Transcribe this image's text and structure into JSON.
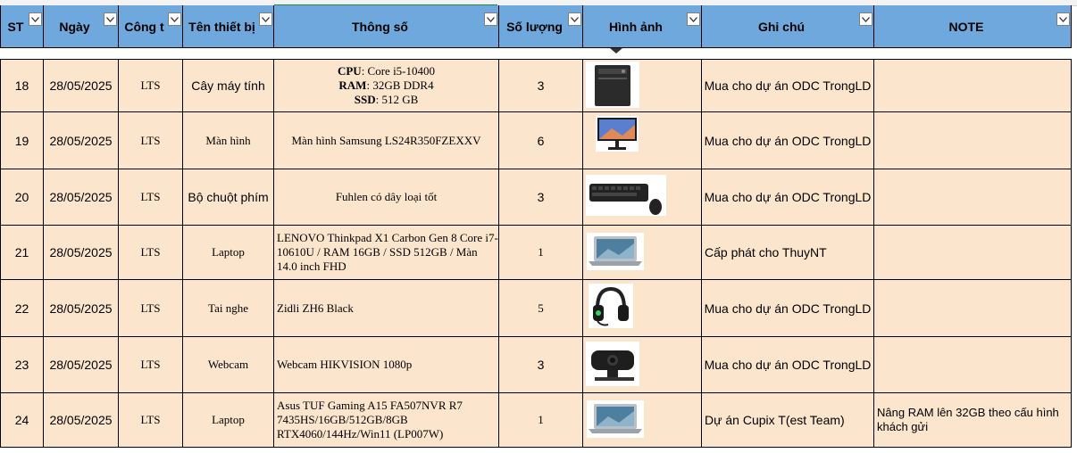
{
  "sheet": {
    "headers": {
      "stt": "ST",
      "ngay": "Ngày",
      "cong_ty": "Công t",
      "ten_thiet_bi": "Tên thiết bị",
      "thong_so": "Thông số",
      "so_luong": "Số lượng",
      "hinh_anh": "Hình ảnh",
      "ghi_chu": "Ghi chú",
      "note": "NOTE"
    },
    "colors": {
      "header_bg": "#6fa8dc",
      "row_bg": "#fce5cd",
      "selected_col": "#1e8e3e"
    },
    "rows": [
      {
        "stt": "18",
        "ngay": "28/05/2025",
        "cong_ty": "LTS",
        "ten": "Cây máy tính",
        "spec": {
          "cpu_label": "CPU",
          "cpu": ": Core i5-10400",
          "ram_label": "RAM",
          "ram": ": 32GB DDR4",
          "ssd_label": "SSD",
          "ssd": ": 512 GB"
        },
        "so_luong": "3",
        "image": "pc-tower-image",
        "ghi_chu": "Mua cho dự án ODC TrongLD",
        "note": ""
      },
      {
        "stt": "19",
        "ngay": "28/05/2025",
        "cong_ty": "LTS",
        "ten": "Màn hình",
        "spec_text": "Màn hình Samsung LS24R350FZEXXV",
        "so_luong": "6",
        "image": "monitor-image",
        "ghi_chu": "Mua cho dự án ODC TrongLD",
        "note": ""
      },
      {
        "stt": "20",
        "ngay": "28/05/2025",
        "cong_ty": "LTS",
        "ten": "Bộ chuột phím",
        "spec_text": "Fuhlen có dây loại tốt",
        "so_luong": "3",
        "image": "keyboard-mouse-image",
        "ghi_chu": "Mua cho dự án ODC TrongLD",
        "note": ""
      },
      {
        "stt": "21",
        "ngay": "28/05/2025",
        "cong_ty": "LTS",
        "ten": "Laptop",
        "spec_text": "LENOVO Thinkpad X1 Carbon Gen 8 Core i7-10610U / RAM 16GB / SSD 512GB / Màn 14.0 inch FHD",
        "so_luong": "1",
        "image": "laptop-image",
        "ghi_chu": "Cấp phát cho ThuyNT",
        "note": ""
      },
      {
        "stt": "22",
        "ngay": "28/05/2025",
        "cong_ty": "LTS",
        "ten": "Tai nghe",
        "spec_text": "Zidli ZH6 Black",
        "so_luong": "5",
        "image": "headset-image",
        "ghi_chu": "Mua cho dự án ODC TrongLD",
        "note": ""
      },
      {
        "stt": "23",
        "ngay": "28/05/2025",
        "cong_ty": "LTS",
        "ten": "Webcam",
        "spec_text": "Webcam HIKVISION 1080p",
        "so_luong": "3",
        "image": "webcam-image",
        "ghi_chu": "Mua cho dự án ODC TrongLD",
        "note": ""
      },
      {
        "stt": "24",
        "ngay": "28/05/2025",
        "cong_ty": "LTS",
        "ten": "Laptop",
        "spec_text": "Asus TUF Gaming A15 FA507NVR R7 7435HS/16GB/512GB/8GB RTX4060/144Hz/Win11 (LP007W)",
        "so_luong": "1",
        "image": "laptop-image",
        "ghi_chu": "Dự án Cupix T(est Team)",
        "note": "Nâng RAM lên 32GB theo cấu hình khách gửi"
      }
    ]
  }
}
